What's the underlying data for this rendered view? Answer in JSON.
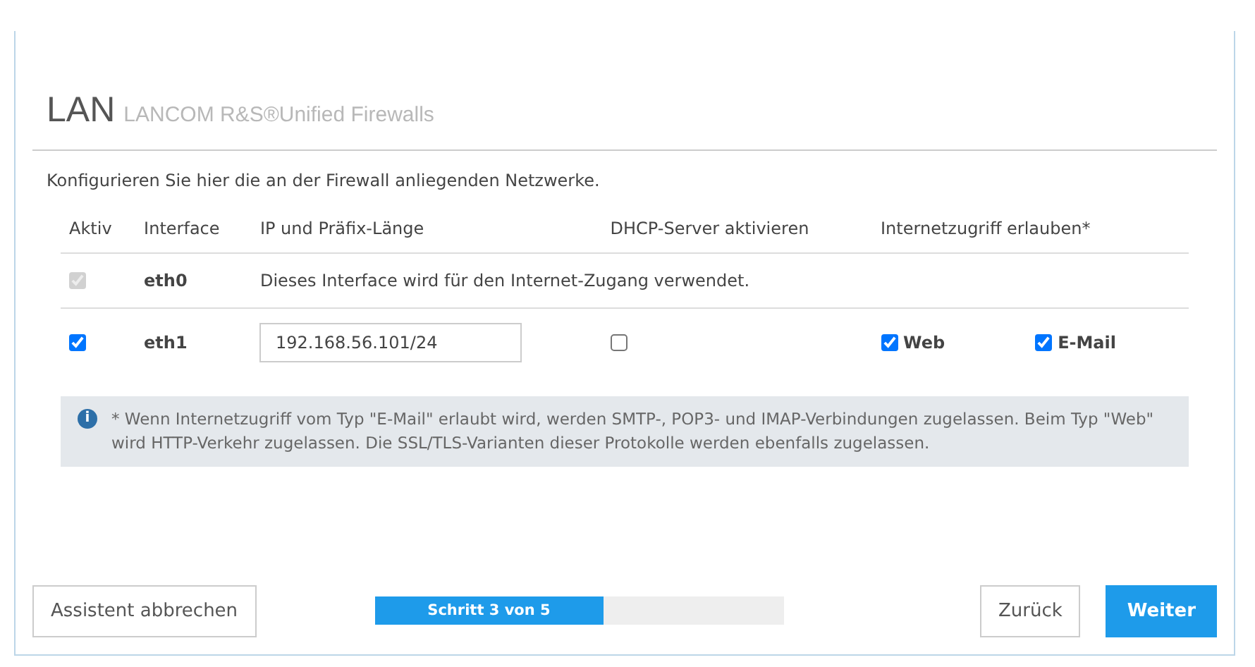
{
  "dialog": {
    "title": "LAN",
    "subtitle": "LANCOM R&S®Unified Firewalls",
    "intro": "Konfigurieren Sie hier die an der Firewall anliegenden Netzwerke."
  },
  "table": {
    "columns": [
      "Aktiv",
      "Interface",
      "IP und Präfix-Länge",
      "DHCP-Server aktivieren",
      "Internetzugriff erlauben*"
    ],
    "rows": [
      {
        "kind": "note",
        "active": {
          "checked": true,
          "disabled": true
        },
        "interface": "eth0",
        "note": "Dieses Interface wird für den Internet-Zugang verwendet."
      },
      {
        "kind": "config",
        "active": {
          "checked": true,
          "disabled": false
        },
        "interface": "eth1",
        "ip": "192.168.56.101/24",
        "dhcp": {
          "checked": false
        },
        "access": [
          {
            "label": "Web",
            "checked": true
          },
          {
            "label": "E-Mail",
            "checked": true
          }
        ]
      }
    ]
  },
  "info": {
    "icon": "i",
    "text": "* Wenn Internetzugriff vom Typ \"E-Mail\" erlaubt wird, werden SMTP-, POP3- und IMAP-Verbindungen zugelassen. Beim Typ \"Web\" wird HTTP-Verkehr zugelassen. Die SSL/TLS-Varianten dieser Protokolle werden ebenfalls zugelassen."
  },
  "footer": {
    "cancel": "Assistent abbrechen",
    "progress": {
      "label": "Schritt 3 von 5",
      "level": 0.56
    },
    "back": "Zurück",
    "next": "Weiter"
  }
}
